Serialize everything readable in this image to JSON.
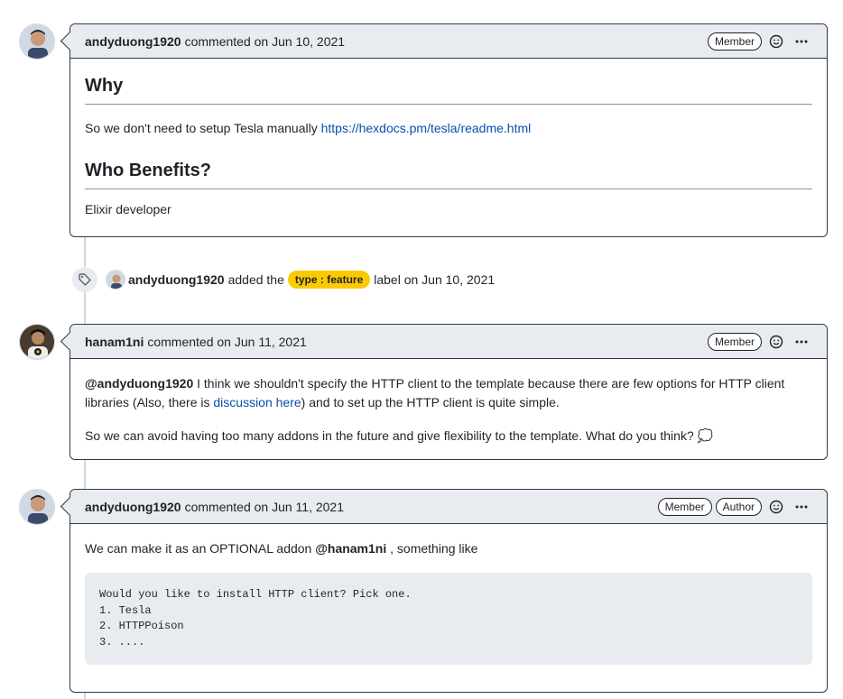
{
  "comments": [
    {
      "author": "andyduong1920",
      "meta": "commented on Jun 10, 2021",
      "badges": [
        "Member"
      ],
      "body": {
        "heading1": "Why",
        "p1_text": "So we don't need to setup Tesla manually ",
        "p1_link": "https://hexdocs.pm/tesla/readme.html",
        "heading2": "Who Benefits?",
        "p2": "Elixir developer"
      }
    },
    {
      "author": "hanam1ni",
      "meta": "commented on Jun 11, 2021",
      "badges": [
        "Member"
      ],
      "body": {
        "mention": "@andyduong1920",
        "p1_a": " I think we shouldn't specify the HTTP client to the template because there are few options for HTTP client libraries (Also, there is ",
        "p1_link": "discussion here",
        "p1_b": ") and to set up the HTTP client is quite simple.",
        "p2": "So we can avoid having too many addons in the future and give flexibility to the template. What do you think? 💭"
      }
    },
    {
      "author": "andyduong1920",
      "meta": "commented on Jun 11, 2021",
      "badges": [
        "Member",
        "Author"
      ],
      "body": {
        "p1_a": "We can make it as an OPTIONAL addon ",
        "mention": "@hanam1ni",
        "p1_b": " , something like",
        "code": "Would you like to install HTTP client? Pick one.\n1. Tesla\n2. HTTPPoison\n3. ...."
      }
    }
  ],
  "event": {
    "actor": "andyduong1920",
    "action": "added the",
    "label": "type : feature",
    "suffix": "label on Jun 10, 2021",
    "label_color": "#fbca04"
  },
  "icons": {
    "reaction": "smiley-icon",
    "more": "kebab-horizontal-icon",
    "event": "tag-icon"
  }
}
